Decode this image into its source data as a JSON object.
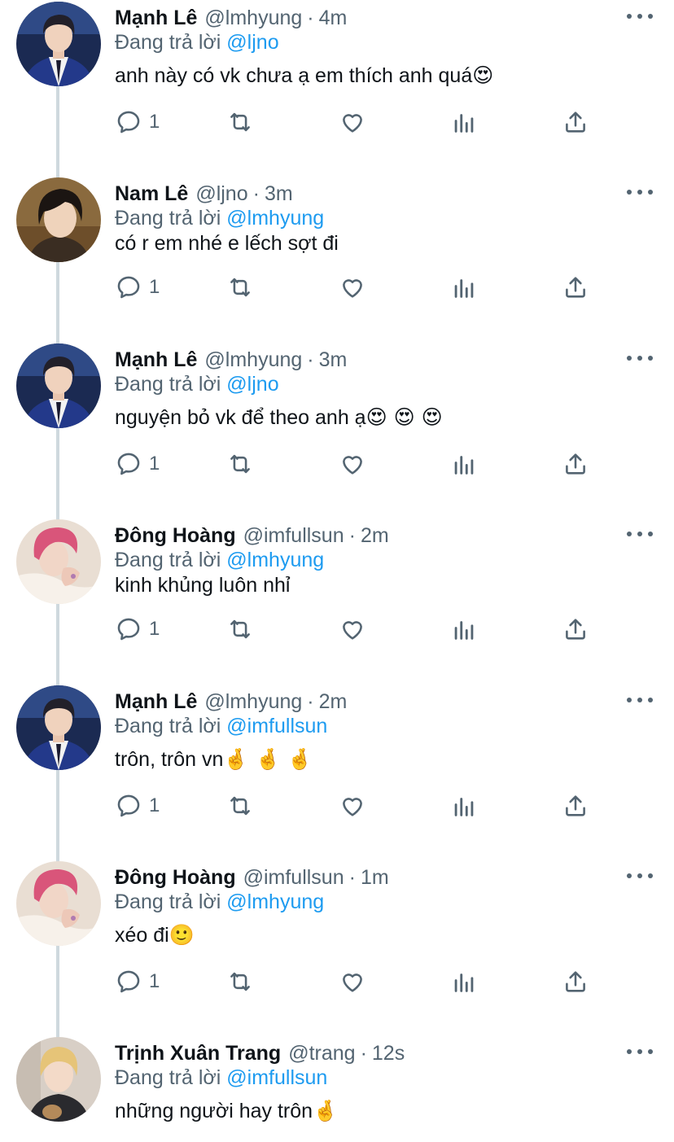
{
  "reply_prefix": "Đang trả lời",
  "dot": "·",
  "tweets": [
    {
      "name": "Mạnh Lê",
      "handle": "@lmhyung",
      "time": "4m",
      "reply_to": "@ljno",
      "text": "anh này có vk chưa ạ em thích anh quá",
      "emoji": "😍",
      "replies": "1",
      "avatar": "avatar-blue-blazer"
    },
    {
      "name": "Nam Lê",
      "handle": "@ljno",
      "time": "3m",
      "reply_to": "@lmhyung",
      "text": "có r em nhé e lếch sợt đi",
      "emoji": "",
      "replies": "1",
      "avatar": "avatar-dark-hair"
    },
    {
      "name": "Mạnh Lê",
      "handle": "@lmhyung",
      "time": "3m",
      "reply_to": "@ljno",
      "text": "nguyện bỏ vk để theo anh ạ",
      "emoji": "😍 😍 😍",
      "replies": "1",
      "avatar": "avatar-blue-blazer"
    },
    {
      "name": "Đông Hoàng",
      "handle": "@imfullsun",
      "time": "2m",
      "reply_to": "@lmhyung",
      "text": "kinh khủng luôn nhỉ",
      "emoji": "",
      "replies": "1",
      "avatar": "avatar-pink-hair"
    },
    {
      "name": "Mạnh Lê",
      "handle": "@lmhyung",
      "time": "2m",
      "reply_to": "@imfullsun",
      "text": "trôn, trôn vn",
      "emoji": "🤞 🤞 🤞",
      "replies": "1",
      "avatar": "avatar-blue-blazer"
    },
    {
      "name": "Đông Hoàng",
      "handle": "@imfullsun",
      "time": "1m",
      "reply_to": "@lmhyung",
      "text": "xéo đi",
      "emoji": "🙂",
      "replies": "1",
      "avatar": "avatar-pink-hair"
    },
    {
      "name": "Trịnh Xuân Trang",
      "handle": "@trang",
      "time": "12s",
      "reply_to": "@imfullsun",
      "text": "những người hay trôn",
      "emoji": "🤞",
      "replies": "",
      "avatar": "avatar-blonde"
    }
  ],
  "colors": {
    "accent": "#1d9bf0",
    "secondary_text": "#536471",
    "primary_text": "#0f1419",
    "thread_line": "#cfd9de"
  },
  "icons": [
    "reply-icon",
    "retweet-icon",
    "like-icon",
    "analytics-icon",
    "share-icon",
    "more-icon"
  ]
}
